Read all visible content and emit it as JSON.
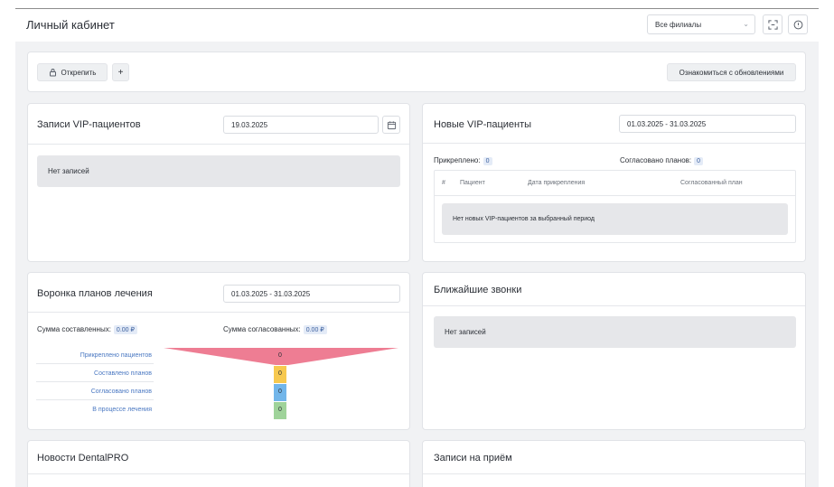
{
  "header": {
    "title": "Личный кабинет",
    "branch_select": "Все филиалы",
    "fullscreen_icon": "fullscreen-icon",
    "info_icon": "info-icon"
  },
  "toolbar": {
    "unpin_label": "Открепить",
    "add_label": "+",
    "updates_label": "Ознакомиться с обновлениями"
  },
  "vip_records": {
    "title": "Записи VIP-пациентов",
    "date": "19.03.2025",
    "empty": "Нет записей"
  },
  "new_vip": {
    "title": "Новые VIP-пациенты",
    "date_range": "01.03.2025 - 31.03.2025",
    "attached_label": "Прикреплено:",
    "attached_count": "0",
    "agreed_label": "Согласовано планов:",
    "agreed_count": "0",
    "columns": [
      "#",
      "Пациент",
      "Дата прикрепления",
      "Согласованный план"
    ],
    "empty": "Нет новых VIP-пациентов за выбранный период"
  },
  "funnel": {
    "title": "Воронка планов лечения",
    "date_range": "01.03.2025 - 31.03.2025",
    "sum_made_label": "Сумма составленных:",
    "sum_made": "0.00 ₽",
    "sum_agreed_label": "Сумма согласованных:",
    "sum_agreed": "0.00 ₽",
    "stages": [
      {
        "label": "Прикреплено пациентов",
        "value": "0",
        "color": "#ee7d93"
      },
      {
        "label": "Составлено планов",
        "value": "0",
        "color": "#f7c94f"
      },
      {
        "label": "Согласовано планов",
        "value": "0",
        "color": "#72b6ea"
      },
      {
        "label": "В процессе лечения",
        "value": "0",
        "color": "#9fd39a"
      }
    ]
  },
  "calls": {
    "title": "Ближайшие звонки",
    "empty": "Нет записей"
  },
  "news": {
    "title": "Новости DentalPRO"
  },
  "appointments": {
    "title": "Записи на приём"
  },
  "colors": {
    "page_bg": "#f1f2f4",
    "card_bg": "#ffffff",
    "empty_bg": "#e6e7ea",
    "link": "#4a78c2"
  }
}
